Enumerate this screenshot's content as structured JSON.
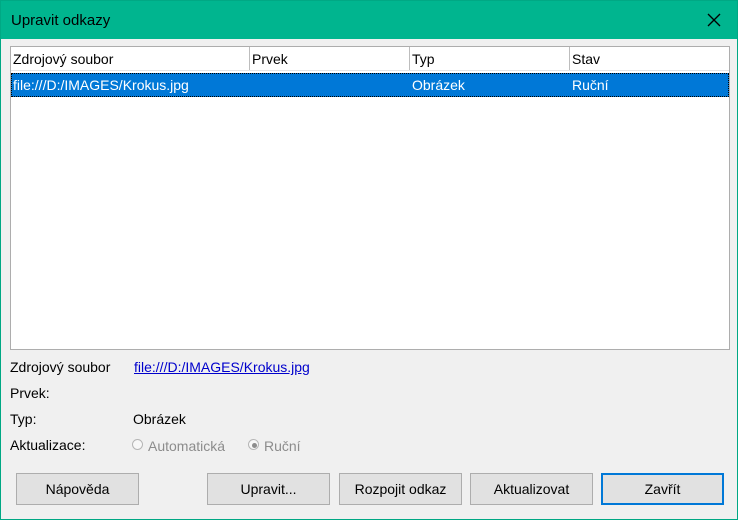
{
  "window": {
    "title": "Upravit odkazy"
  },
  "table": {
    "columns": [
      "Zdrojový soubor",
      "Prvek",
      "Typ",
      "Stav"
    ],
    "rows": [
      {
        "source": "file:///D:/IMAGES/Krokus.jpg",
        "element": "",
        "type": "Obrázek",
        "status": "Ruční",
        "selected": true
      }
    ]
  },
  "details": {
    "source_label": "Zdrojový soubor",
    "source_value": "file:///D:/IMAGES/Krokus.jpg",
    "element_label": "Prvek:",
    "element_value": "",
    "type_label": "Typ:",
    "type_value": "Obrázek",
    "update_label": "Aktualizace:",
    "update_options": [
      "Automatická",
      "Ruční"
    ],
    "update_selected": "Ruční",
    "update_enabled": false
  },
  "buttons": {
    "help": "Nápověda",
    "edit": "Upravit...",
    "break_link": "Rozpojit odkaz",
    "update": "Aktualizovat",
    "close": "Zavřít"
  },
  "colors": {
    "titlebar": "#00b58f",
    "selection": "#0078d7",
    "link": "#0000cc"
  }
}
